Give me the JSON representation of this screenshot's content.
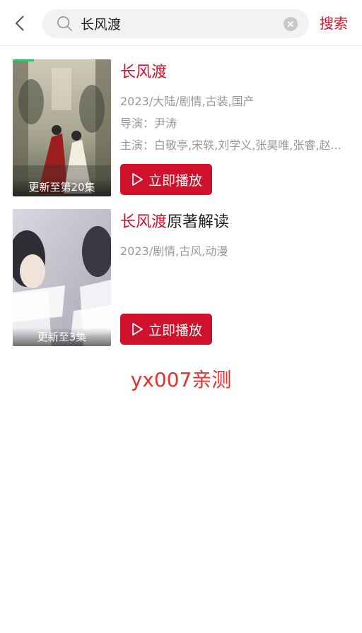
{
  "header": {
    "search_value": "长风渡",
    "search_button": "搜索"
  },
  "results": [
    {
      "title_highlight": "长风渡",
      "title_rest": "",
      "meta_line_1": "2023/大陆/剧情,古装,国产",
      "director_label": "导演：",
      "director": "尹涛",
      "cast_label": "主演：",
      "cast": "白敬亭,宋轶,刘学义,张昊唯,张睿,赵...",
      "poster_badge": "更新至第20集",
      "play_label": "立即播放"
    },
    {
      "title_highlight": "长风渡",
      "title_rest": "原著解读",
      "meta_line_1": "2023/剧情,古风,动漫",
      "poster_badge": "更新至3集",
      "play_label": "立即播放"
    }
  ],
  "footer": {
    "note": "yx007亲测"
  },
  "colors": {
    "accent": "#d0112b",
    "meta_text": "#999999",
    "footer_text": "#e8312f"
  }
}
